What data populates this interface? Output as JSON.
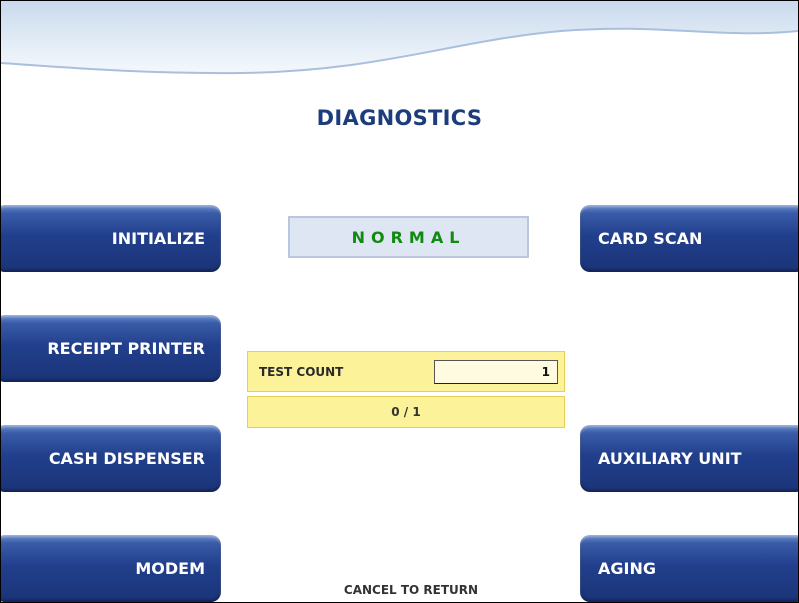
{
  "screen": {
    "title": "DIAGNOSTICS"
  },
  "left_keys": [
    {
      "label": "INITIALIZE"
    },
    {
      "label": "RECEIPT PRINTER"
    },
    {
      "label": "CASH DISPENSER"
    },
    {
      "label": "MODEM"
    }
  ],
  "right_keys": [
    {
      "label": "CARD SCAN"
    },
    {
      "label": "AUXILIARY UNIT"
    },
    {
      "label": "AGING"
    }
  ],
  "status": {
    "text": "NORMAL"
  },
  "test": {
    "label": "TEST COUNT",
    "value": "1",
    "progress": "0 / 1"
  },
  "footer": {
    "text": "CANCEL TO RETURN"
  },
  "colors": {
    "button_blue": "#213f8c",
    "status_green": "#108a10",
    "title_blue": "#1c3c7c",
    "panel_yellow": "#fcf29a"
  }
}
